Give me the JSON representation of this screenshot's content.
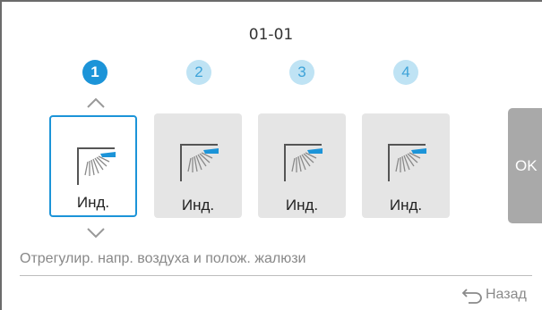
{
  "header": {
    "title": "01-01"
  },
  "units": [
    {
      "number": "1",
      "label": "Инд.",
      "active": true
    },
    {
      "number": "2",
      "label": "Инд.",
      "active": false
    },
    {
      "number": "3",
      "label": "Инд.",
      "active": false
    },
    {
      "number": "4",
      "label": "Инд.",
      "active": false
    }
  ],
  "ok_button": {
    "label": "OK"
  },
  "hint": "Отрегулир. напр. воздуха и полож. жалюзи",
  "back": {
    "label": "Назад"
  },
  "colors": {
    "accent": "#1c94d8",
    "accent_light": "#bfe3f4",
    "tile_bg": "#e5e5e5",
    "ok_bg": "#a9a9a9"
  }
}
